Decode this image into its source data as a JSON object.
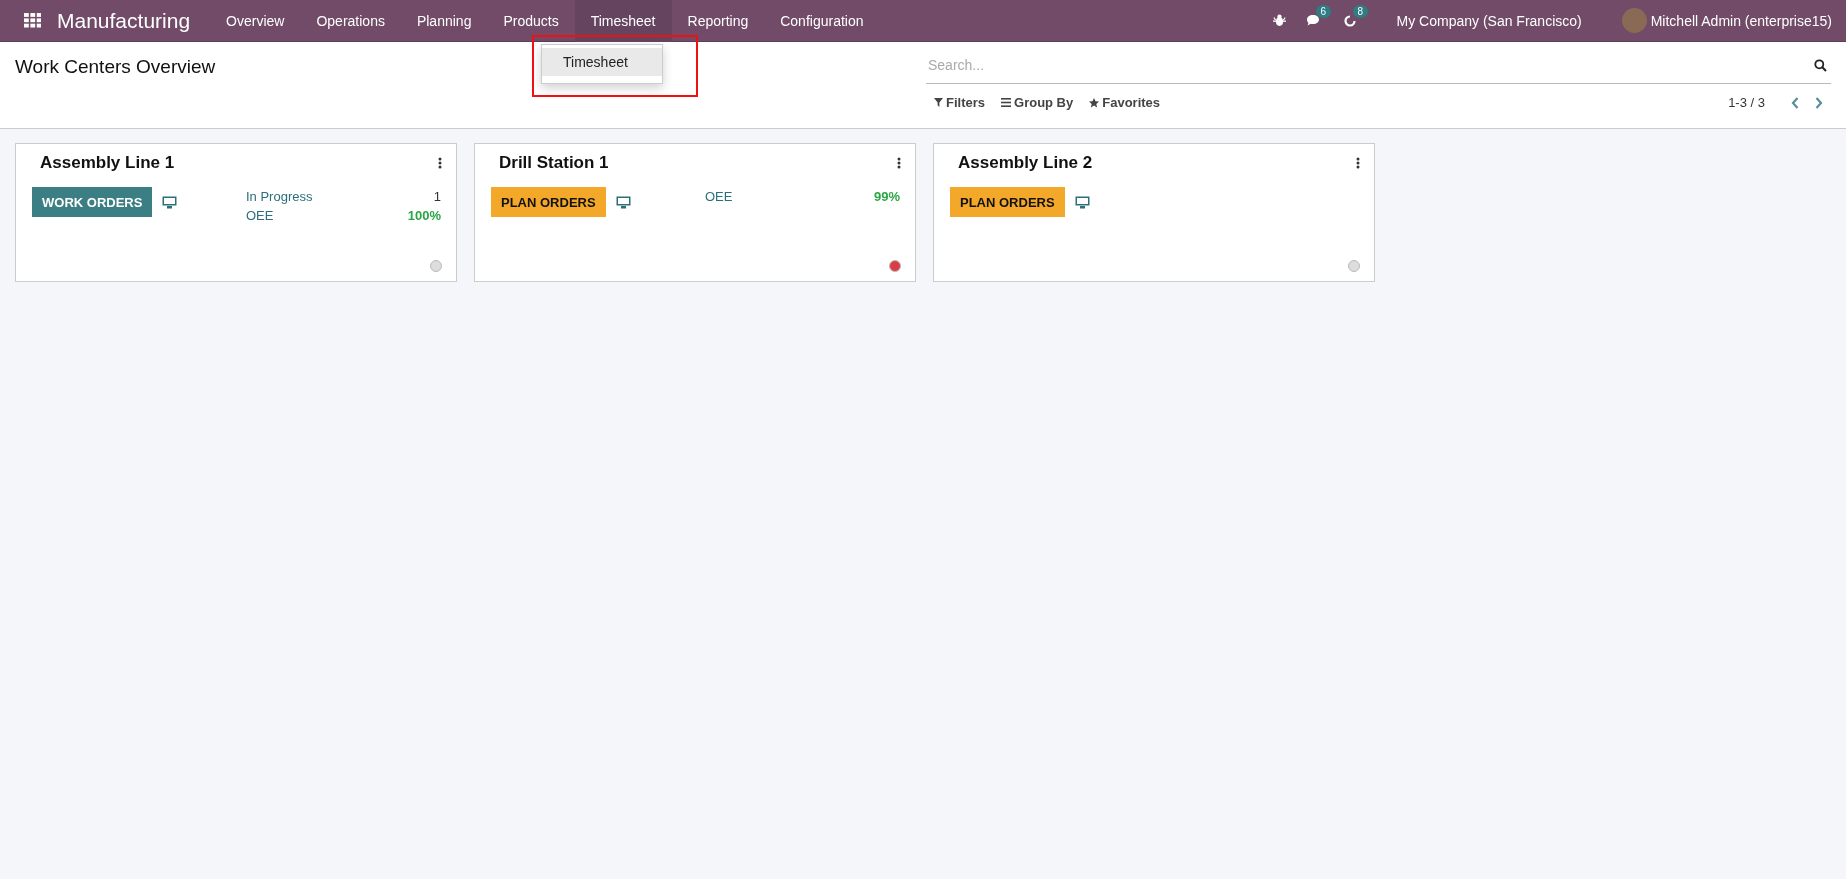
{
  "navbar": {
    "app_name": "Manufacturing",
    "menu": [
      {
        "label": "Overview",
        "selected": false
      },
      {
        "label": "Operations",
        "selected": false
      },
      {
        "label": "Planning",
        "selected": false
      },
      {
        "label": "Products",
        "selected": false
      },
      {
        "label": "Timesheet",
        "selected": true
      },
      {
        "label": "Reporting",
        "selected": false
      },
      {
        "label": "Configuration",
        "selected": false
      }
    ],
    "messages_count": "6",
    "activities_count": "8",
    "company": "My Company (San Francisco)",
    "user": "Mitchell Admin (enterprise15)"
  },
  "dropdown": {
    "items": [
      "Timesheet"
    ]
  },
  "control_panel": {
    "title": "Work Centers Overview",
    "search": {
      "placeholder": "Search..."
    },
    "filters": [
      "Filters",
      "Group By",
      "Favorites"
    ],
    "pager": "1-3 / 3"
  },
  "cards": [
    {
      "name": "Assembly Line 1",
      "button": {
        "kind": "work",
        "label": "WORK ORDERS"
      },
      "stats": [
        {
          "kind": "count",
          "label": "In Progress",
          "value": "1"
        },
        {
          "kind": "oee",
          "label": "OEE",
          "value": "100%"
        }
      ],
      "color": "#dddddd"
    },
    {
      "name": "Drill Station 1",
      "button": {
        "kind": "plan",
        "label": "PLAN ORDERS"
      },
      "stats": [
        {
          "kind": "oee",
          "label": "OEE",
          "value": "99%"
        }
      ],
      "color": "#dc3c45"
    },
    {
      "name": "Assembly Line 2",
      "button": {
        "kind": "plan",
        "label": "PLAN ORDERS"
      },
      "color": "#dddddd"
    }
  ]
}
